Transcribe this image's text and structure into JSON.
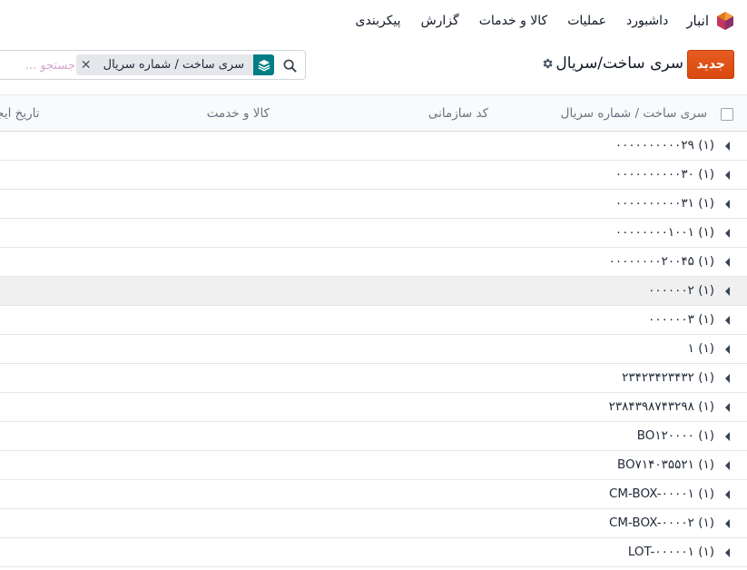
{
  "navbar": {
    "app_name": "انبار",
    "logo_icon": "odoo-inventory-hexagon-icon",
    "menu": [
      "داشبورد",
      "عملیات",
      "کالا و خدمات",
      "گزارش",
      "پیکربندی"
    ]
  },
  "control": {
    "new_label": "جدید",
    "title": "سری ساخت/سریال",
    "gear_icon": "gear-icon",
    "search": {
      "facet_label": "سری ساخت / شماره سریال",
      "facet_icon": "layers-icon",
      "remove_icon": "close-icon",
      "placeholder": "جستجو ..."
    }
  },
  "table": {
    "headers": {
      "lot": "سری ساخت / شماره سریال",
      "ref": "کد سازمانی",
      "product": "کالا و خدمت",
      "created": "تاریخ ایجاد"
    },
    "groups": [
      {
        "label": "۰۰۰۰۰۰۰۰۰۰۲۹ (۱)"
      },
      {
        "label": "۰۰۰۰۰۰۰۰۰۰۳۰ (۱)"
      },
      {
        "label": "۰۰۰۰۰۰۰۰۰۰۳۱ (۱)"
      },
      {
        "label": "۰۰۰۰۰۰۰۰۱۰۰۱ (۱)"
      },
      {
        "label": "۰۰۰۰۰۰۰۰۲۰۰۴۵ (۱)"
      },
      {
        "label": "۰۰۰۰۰۰۲ (۱)"
      },
      {
        "label": "۰۰۰۰۰۰۳ (۱)"
      },
      {
        "label": "۱ (۱)"
      },
      {
        "label": "۲۳۴۲۳۴۲۳۴۳۲ (۱)"
      },
      {
        "label": "۲۳۸۴۳۹۸۷۴۳۲۹۸ (۱)"
      },
      {
        "label": "BO۱۲۰۰۰۰ (۱)"
      },
      {
        "label": "BO۷۱۴۰۳۵۵۲۱ (۱)"
      },
      {
        "label": "CM-BOX-۰۰۰۰۱ (۱)"
      },
      {
        "label": "CM-BOX-۰۰۰۰۲ (۱)"
      },
      {
        "label": "LOT-۰۰۰۰۰۱ (۱)"
      }
    ],
    "hover_index": 5
  }
}
